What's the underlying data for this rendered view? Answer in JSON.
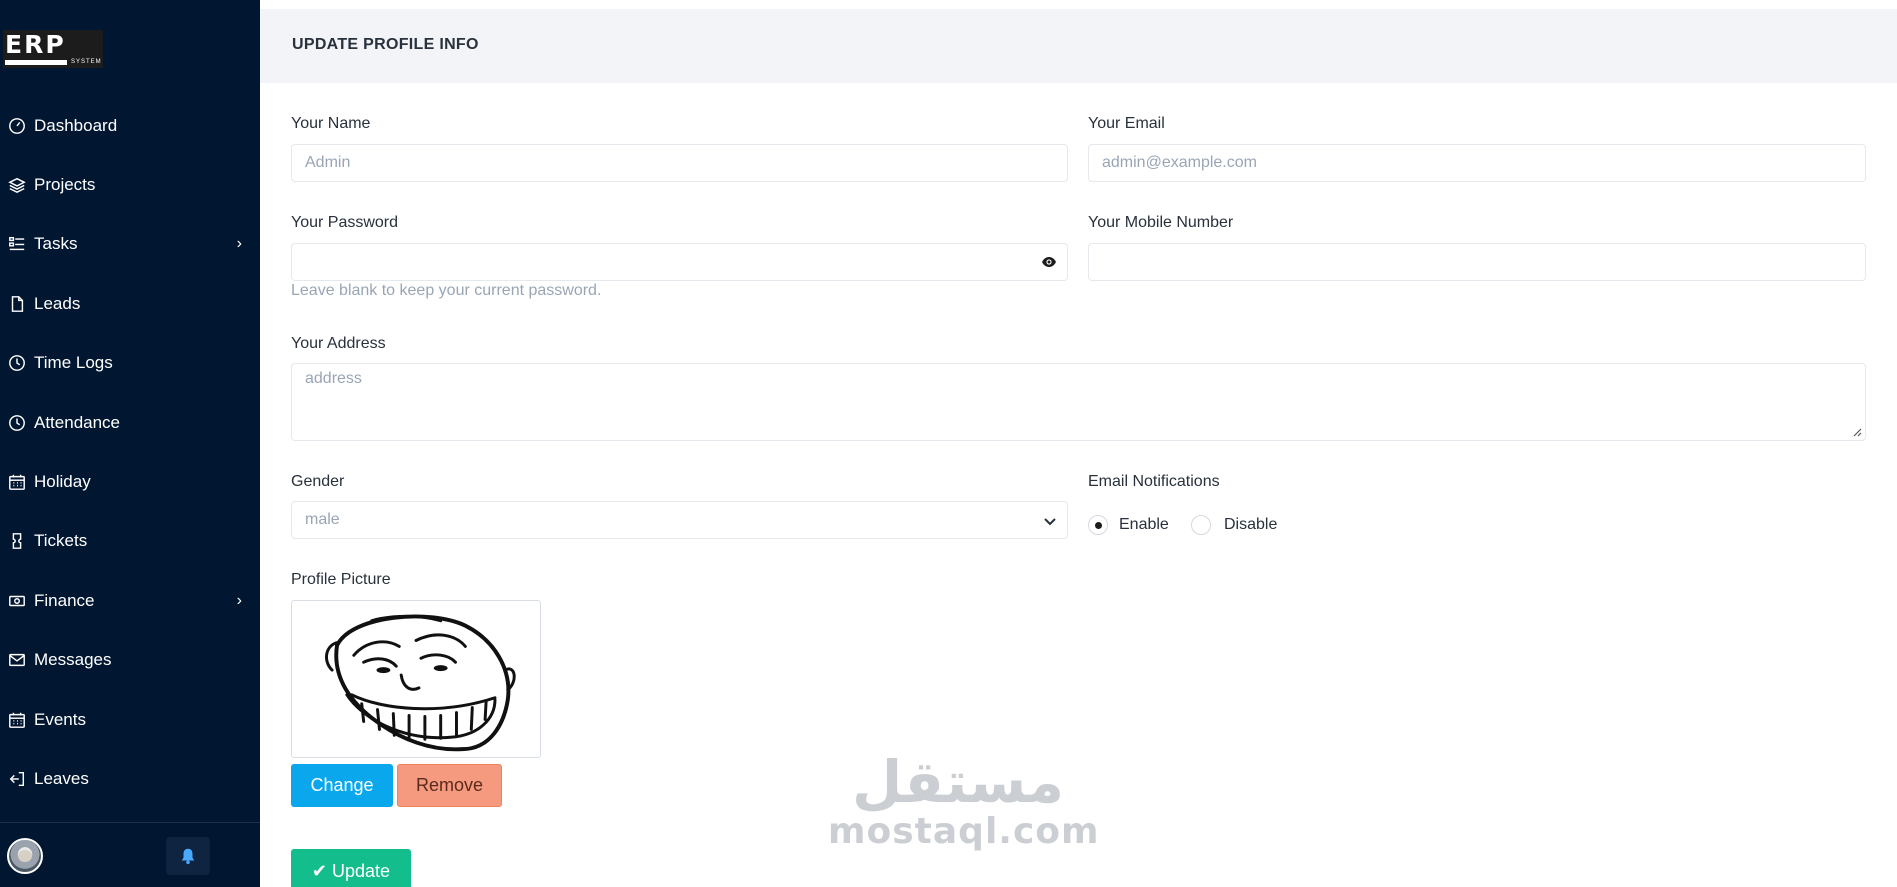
{
  "logo": {
    "text": "ERP",
    "subtext": "SYSTEM"
  },
  "sidebar": {
    "items": [
      {
        "label": "Dashboard",
        "icon": "dashboard-gauge-icon",
        "has_submenu": false
      },
      {
        "label": "Projects",
        "icon": "layers-icon",
        "has_submenu": false
      },
      {
        "label": "Tasks",
        "icon": "task-list-icon",
        "has_submenu": true
      },
      {
        "label": "Leads",
        "icon": "document-icon",
        "has_submenu": false
      },
      {
        "label": "Time Logs",
        "icon": "clock-icon",
        "has_submenu": false
      },
      {
        "label": "Attendance",
        "icon": "clock-icon",
        "has_submenu": false
      },
      {
        "label": "Holiday",
        "icon": "calendar-icon",
        "has_submenu": false
      },
      {
        "label": "Tickets",
        "icon": "ticket-icon",
        "has_submenu": false
      },
      {
        "label": "Finance",
        "icon": "cash-icon",
        "has_submenu": true
      },
      {
        "label": "Messages",
        "icon": "envelope-icon",
        "has_submenu": false
      },
      {
        "label": "Events",
        "icon": "calendar-icon",
        "has_submenu": false
      },
      {
        "label": "Leaves",
        "icon": "logout-icon",
        "has_submenu": false
      }
    ],
    "chevron": "›"
  },
  "page": {
    "title": "UPDATE PROFILE INFO"
  },
  "form": {
    "name": {
      "label": "Your Name",
      "value": "Admin"
    },
    "email": {
      "label": "Your Email",
      "value": "admin@example.com"
    },
    "password": {
      "label": "Your Password",
      "value": "",
      "help": "Leave blank to keep your current password."
    },
    "mobile": {
      "label": "Your Mobile Number",
      "value": ""
    },
    "address": {
      "label": "Your Address",
      "placeholder": "address"
    },
    "gender": {
      "label": "Gender",
      "selected": "male"
    },
    "email_notifications": {
      "label": "Email Notifications",
      "options": [
        "Enable",
        "Disable"
      ],
      "selected": "Enable"
    },
    "profile_picture": {
      "label": "Profile Picture",
      "change_label": "Change",
      "remove_label": "Remove"
    },
    "update_label": "Update"
  },
  "watermark": {
    "arabic": "مستقل",
    "latin": "mostaql.com"
  },
  "colors": {
    "sidebar_bg": "#011631",
    "primary": "#0ba7ec",
    "danger": "#f59a7f",
    "success": "#13be8c"
  }
}
